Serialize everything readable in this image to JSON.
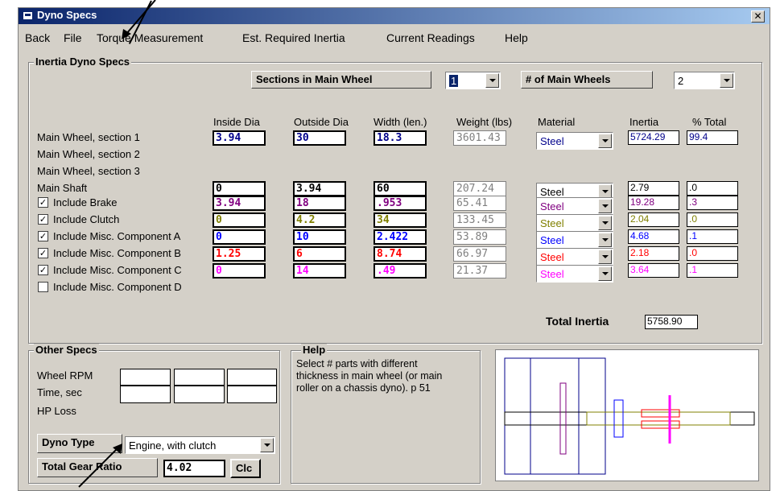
{
  "window": {
    "title": "Dyno Specs",
    "close_glyph": "✕"
  },
  "menu": [
    "Back",
    "File",
    "Torque Measurement",
    "Est. Required Inertia",
    "Current Readings",
    "Help"
  ],
  "inertia_group": {
    "title": "Inertia Dyno Specs",
    "sections_label": "Sections in Main Wheel",
    "sections_value": "1",
    "wheels_label": "# of Main Wheels",
    "wheels_value": "2",
    "headers": [
      "Inside Dia",
      "Outside Dia",
      "Width (len.)",
      "Weight (lbs)",
      "Material",
      "Inertia",
      "% Total"
    ],
    "rows": [
      {
        "label": "Main Wheel, section 1",
        "checkbox": false,
        "checked": false,
        "inside": "3.94",
        "outside": "30",
        "width": "18.3",
        "weight": "3601.43",
        "material": "Steel",
        "inertia": "5724.29",
        "pct": "99.4",
        "color": "#00008b"
      },
      {
        "label": "Main Wheel, section 2",
        "checkbox": false,
        "checked": false
      },
      {
        "label": "Main Wheel, section 3",
        "checkbox": false,
        "checked": false
      },
      {
        "label": "Main Shaft",
        "checkbox": false,
        "checked": false,
        "inside": "0",
        "outside": "3.94",
        "width": "60",
        "weight": "207.24",
        "material": "Steel",
        "inertia": "2.79",
        "pct": ".0",
        "color": "#000000"
      },
      {
        "label": "Include Brake",
        "checkbox": true,
        "checked": true,
        "inside": "3.94",
        "outside": "18",
        "width": ".953",
        "weight": "65.41",
        "material": "Steel",
        "inertia": "19.28",
        "pct": ".3",
        "color": "#800080"
      },
      {
        "label": "Include Clutch",
        "checkbox": true,
        "checked": true,
        "inside": "0",
        "outside": "4.2",
        "width": "34",
        "weight": "133.45",
        "material": "Steel",
        "inertia": "2.04",
        "pct": ".0",
        "color": "#808000"
      },
      {
        "label": "Include Misc. Component A",
        "checkbox": true,
        "checked": true,
        "inside": "0",
        "outside": "10",
        "width": "2.422",
        "weight": "53.89",
        "material": "Steel",
        "inertia": "4.68",
        "pct": ".1",
        "color": "#0000ff"
      },
      {
        "label": "Include Misc. Component B",
        "checkbox": true,
        "checked": true,
        "inside": "1.25",
        "outside": "6",
        "width": "8.74",
        "weight": "66.97",
        "material": "Steel",
        "inertia": "2.18",
        "pct": ".0",
        "color": "#ff0000"
      },
      {
        "label": "Include Misc. Component C",
        "checkbox": true,
        "checked": true,
        "inside": "0",
        "outside": "14",
        "width": ".49",
        "weight": "21.37",
        "material": "Steel",
        "inertia": "3.64",
        "pct": ".1",
        "color": "#ff00ff"
      },
      {
        "label": "Include Misc. Component D",
        "checkbox": true,
        "checked": false
      }
    ],
    "total_label": "Total Inertia",
    "total_value": "5758.90"
  },
  "other_specs": {
    "title": "Other Specs",
    "wheel_rpm_label": "Wheel RPM",
    "time_label": "Time, sec",
    "hp_loss_label": "HP Loss",
    "dyno_type_label": "Dyno Type",
    "dyno_type_value": "Engine, with clutch",
    "gear_ratio_label": "Total Gear Ratio",
    "gear_ratio_value": "4.02",
    "calc_button": "Clc"
  },
  "help": {
    "title": "Help",
    "text": "Select # parts with different thickness in main wheel (or main roller on a chassis dyno).  p 51"
  }
}
